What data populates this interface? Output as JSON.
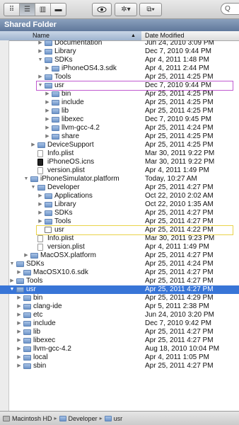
{
  "toolbar": {
    "view_icons": [
      "⠿",
      "☰",
      "▥",
      "▬"
    ],
    "quicklook_icon": "eye-icon",
    "action_label": "✲▾",
    "dropbox_label": "⧉▾",
    "search_glyph": "Q"
  },
  "window": {
    "title": "Shared Folder"
  },
  "columns": {
    "name": "Name",
    "date": "Date Modified",
    "sort": "▲"
  },
  "rows": [
    {
      "name": "Documentation",
      "date": "Jun 24, 2010 3:09 PM",
      "kind": "folder",
      "indent": 5,
      "arrow": "▶"
    },
    {
      "name": "Library",
      "date": "Dec 7, 2010 9:44 PM",
      "kind": "folder",
      "indent": 5,
      "arrow": "▶"
    },
    {
      "name": "SDKs",
      "date": "Apr 4, 2011 1:48 PM",
      "kind": "folder",
      "indent": 5,
      "arrow": "▼"
    },
    {
      "name": "iPhoneOS4.3.sdk",
      "date": "Apr 4, 2011 2:44 PM",
      "kind": "folder",
      "indent": 6,
      "arrow": "▶"
    },
    {
      "name": "Tools",
      "date": "Apr 25, 2011 4:25 PM",
      "kind": "folder",
      "indent": 5,
      "arrow": "▶"
    },
    {
      "name": "usr",
      "date": "Dec 7, 2010 9:44 PM",
      "kind": "folder",
      "indent": 5,
      "arrow": "▼"
    },
    {
      "name": "bin",
      "date": "Apr 25, 2011 4:25 PM",
      "kind": "folder",
      "indent": 6,
      "arrow": "▶"
    },
    {
      "name": "include",
      "date": "Apr 25, 2011 4:25 PM",
      "kind": "folder",
      "indent": 6,
      "arrow": "▶"
    },
    {
      "name": "lib",
      "date": "Apr 25, 2011 4:25 PM",
      "kind": "folder",
      "indent": 6,
      "arrow": "▶"
    },
    {
      "name": "libexec",
      "date": "Dec 7, 2010 9:45 PM",
      "kind": "folder",
      "indent": 6,
      "arrow": "▶"
    },
    {
      "name": "llvm-gcc-4.2",
      "date": "Apr 25, 2011 4:24 PM",
      "kind": "folder",
      "indent": 6,
      "arrow": "▶"
    },
    {
      "name": "share",
      "date": "Apr 25, 2011 4:25 PM",
      "kind": "folder",
      "indent": 6,
      "arrow": "▶"
    },
    {
      "name": "DeviceSupport",
      "date": "Apr 25, 2011 4:25 PM",
      "kind": "folder",
      "indent": 4,
      "arrow": "▶"
    },
    {
      "name": "Info.plist",
      "date": "Mar 30, 2011 9:22 PM",
      "kind": "file",
      "indent": 4,
      "arrow": ""
    },
    {
      "name": "iPhoneOS.icns",
      "date": "Mar 30, 2011 9:22 PM",
      "kind": "icns",
      "indent": 4,
      "arrow": ""
    },
    {
      "name": "version.plist",
      "date": "Apr 4, 2011 1:49 PM",
      "kind": "file",
      "indent": 4,
      "arrow": ""
    },
    {
      "name": "iPhoneSimulator.platform",
      "date": "Today, 10:27 AM",
      "kind": "folder",
      "indent": 3,
      "arrow": "▼"
    },
    {
      "name": "Developer",
      "date": "Apr 25, 2011 4:27 PM",
      "kind": "folder",
      "indent": 4,
      "arrow": "▼"
    },
    {
      "name": "Applications",
      "date": "Oct 22, 2010 2:02 AM",
      "kind": "folder",
      "indent": 5,
      "arrow": "▶"
    },
    {
      "name": "Library",
      "date": "Oct 22, 2010 1:35 AM",
      "kind": "folder",
      "indent": 5,
      "arrow": "▶"
    },
    {
      "name": "SDKs",
      "date": "Apr 25, 2011 4:27 PM",
      "kind": "folder",
      "indent": 5,
      "arrow": "▶"
    },
    {
      "name": "Tools",
      "date": "Apr 25, 2011 4:27 PM",
      "kind": "folder",
      "indent": 5,
      "arrow": "▶"
    },
    {
      "name": "usr",
      "date": "Apr 25, 2011 4:22 PM",
      "kind": "shortcut",
      "indent": 5,
      "arrow": ""
    },
    {
      "name": "Info.plist",
      "date": "Mar 30, 2011 9:23 PM",
      "kind": "file",
      "indent": 4,
      "arrow": ""
    },
    {
      "name": "version.plist",
      "date": "Apr 4, 2011 1:49 PM",
      "kind": "file",
      "indent": 4,
      "arrow": ""
    },
    {
      "name": "MacOSX.platform",
      "date": "Apr 25, 2011 4:27 PM",
      "kind": "folder",
      "indent": 3,
      "arrow": "▶"
    },
    {
      "name": "SDKs",
      "date": "Apr 25, 2011 4:24 PM",
      "kind": "folder",
      "indent": 1,
      "arrow": "▼"
    },
    {
      "name": "MacOSX10.6.sdk",
      "date": "Apr 25, 2011 4:27 PM",
      "kind": "folder",
      "indent": 2,
      "arrow": "▶"
    },
    {
      "name": "Tools",
      "date": "Apr 25, 2011 4:27 PM",
      "kind": "folder",
      "indent": 1,
      "arrow": "▶"
    },
    {
      "name": "usr",
      "date": "Apr 25, 2011 4:27 PM",
      "kind": "folder",
      "indent": 1,
      "arrow": "▼",
      "selected": true
    },
    {
      "name": "bin",
      "date": "Apr 25, 2011 4:29 PM",
      "kind": "folder",
      "indent": 2,
      "arrow": "▶"
    },
    {
      "name": "clang-ide",
      "date": "Apr 5, 2011 2:38 PM",
      "kind": "folder",
      "indent": 2,
      "arrow": "▶"
    },
    {
      "name": "etc",
      "date": "Jun 24, 2010 3:20 PM",
      "kind": "folder",
      "indent": 2,
      "arrow": "▶"
    },
    {
      "name": "include",
      "date": "Dec 7, 2010 9:42 PM",
      "kind": "folder",
      "indent": 2,
      "arrow": "▶"
    },
    {
      "name": "lib",
      "date": "Apr 25, 2011 4:27 PM",
      "kind": "folder",
      "indent": 2,
      "arrow": "▶"
    },
    {
      "name": "libexec",
      "date": "Apr 25, 2011 4:27 PM",
      "kind": "folder",
      "indent": 2,
      "arrow": "▶"
    },
    {
      "name": "llvm-gcc-4.2",
      "date": "Aug 18, 2010 10:04 PM",
      "kind": "folder",
      "indent": 2,
      "arrow": "▶"
    },
    {
      "name": "local",
      "date": "Apr 4, 2011 1:05 PM",
      "kind": "folder",
      "indent": 2,
      "arrow": "▶"
    },
    {
      "name": "sbin",
      "date": "Apr 25, 2011 4:27 PM",
      "kind": "folder",
      "indent": 2,
      "arrow": "▶"
    }
  ],
  "highlights": [
    {
      "row": 5,
      "color": "purple"
    },
    {
      "row": 22,
      "color": "yellow"
    }
  ],
  "pathbar": [
    {
      "label": "Macintosh HD",
      "icon": "hard-drive-icon"
    },
    {
      "label": "Developer",
      "icon": "folder-icon"
    },
    {
      "label": "usr",
      "icon": "folder-icon"
    }
  ],
  "path_separator": "▸"
}
